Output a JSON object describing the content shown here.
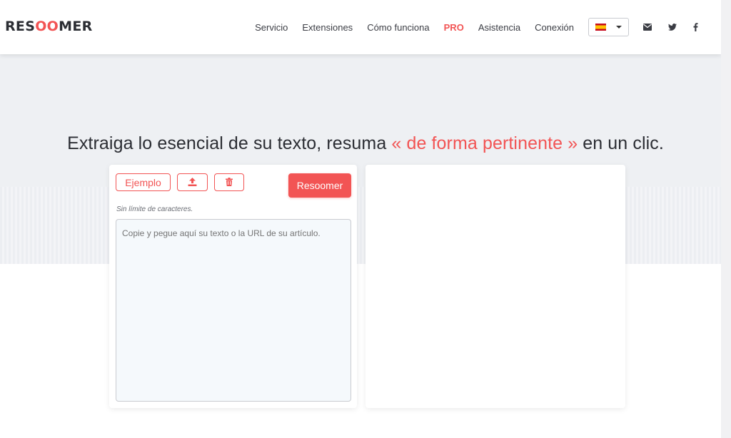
{
  "logo": {
    "prefix": "RES",
    "accent": "OO",
    "suffix": "MER"
  },
  "nav": {
    "items": [
      {
        "label": "Servicio"
      },
      {
        "label": "Extensiones"
      },
      {
        "label": "Cómo funciona"
      },
      {
        "label": "PRO"
      },
      {
        "label": "Asistencia"
      },
      {
        "label": "Conexión"
      }
    ],
    "language": {
      "icon": "spain-flag-icon"
    }
  },
  "social": {
    "icons": [
      "envelope-icon",
      "twitter-icon",
      "facebook-icon"
    ]
  },
  "hero": {
    "headline_before": "Extraiga lo esencial de su texto, resuma ",
    "headline_highlight": "« de forma pertinente »",
    "headline_after": " en un clic."
  },
  "editor": {
    "example_label": "Ejemplo",
    "upload_icon": "upload-icon",
    "delete_icon": "trash-icon",
    "submit_label": "Resoomer",
    "hint": "Sin límite de caracteres.",
    "placeholder": "Copie y pegue aquí su texto o la URL de su artículo."
  },
  "colors": {
    "accent": "#f25454",
    "hero_bg": "#eef0f3",
    "text": "#2b2d33"
  }
}
